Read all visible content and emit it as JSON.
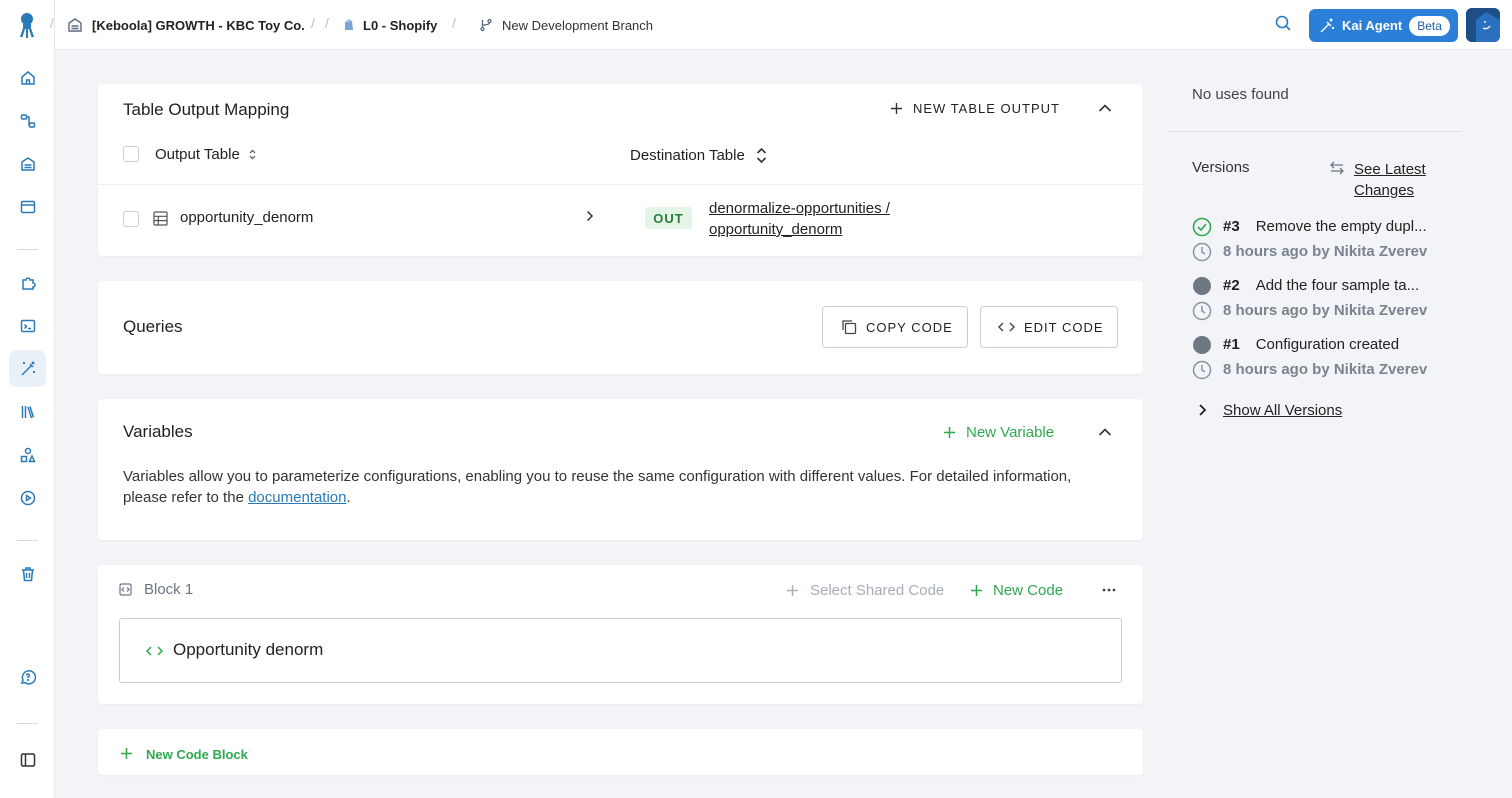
{
  "topbar": {
    "project": "[Keboola] GROWTH - KBC Toy Co.",
    "config": "L0 - Shopify",
    "branch": "New Development Branch",
    "kai_label": "Kai Agent",
    "kai_badge": "Beta"
  },
  "sidebar": {
    "items": [
      "home-icon",
      "flows-icon",
      "storage-icon",
      "data-apps-icon",
      "components-icon",
      "terminal-icon",
      "transformations-icon",
      "library-icon",
      "templates-icon",
      "jobs-icon",
      "trash-icon",
      "help-icon",
      "collapse-sidebar-icon"
    ]
  },
  "output_mapping": {
    "title": "Table Output Mapping",
    "add_label": "NEW TABLE OUTPUT",
    "col_output": "Output Table",
    "col_destination": "Destination Table",
    "rows": [
      {
        "source": "opportunity_denorm",
        "badge": "OUT",
        "dest_line1": "denormalize-opportunities /",
        "dest_line2": "opportunity_denorm"
      }
    ]
  },
  "queries": {
    "title": "Queries",
    "copy_label": "COPY CODE",
    "edit_label": "EDIT CODE"
  },
  "variables": {
    "title": "Variables",
    "add_label": "New Variable",
    "desc_before": "Variables allow you to parameterize configurations, enabling you to reuse the same configuration with different values. For detailed information, please refer to the ",
    "desc_link": "documentation",
    "desc_after": "."
  },
  "block": {
    "title": "Block 1",
    "shared_label": "Select Shared Code",
    "new_code_label": "New Code",
    "code_name": "Opportunity denorm"
  },
  "new_block_label": "New Code Block",
  "right_panel": {
    "no_uses": "No uses found",
    "versions_title": "Versions",
    "latest_line1": "See Latest",
    "latest_line2": "Changes",
    "versions": [
      {
        "num": "#3",
        "desc": "Remove the empty dupl...",
        "meta": "8 hours ago by Nikita Zverev",
        "current": true
      },
      {
        "num": "#2",
        "desc": "Add the four sample ta...",
        "meta": "8 hours ago by Nikita Zverev",
        "current": false
      },
      {
        "num": "#1",
        "desc": "Configuration created",
        "meta": "8 hours ago by Nikita Zverev",
        "current": false
      }
    ],
    "show_all": "Show All Versions"
  },
  "colors": {
    "accent": "#2a7ab8",
    "green": "#2fa84f",
    "kai": "#2b7fd6"
  }
}
